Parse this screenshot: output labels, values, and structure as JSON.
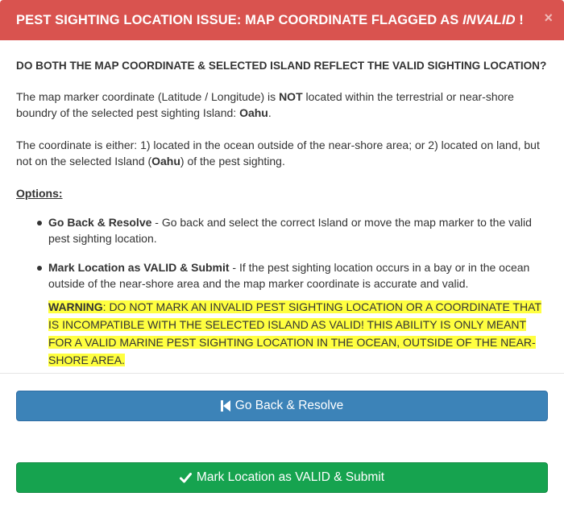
{
  "header": {
    "title_prefix": "PEST SIGHTING LOCATION ISSUE: MAP COORDINATE FLAGGED AS ",
    "title_emph": "INVALID",
    "title_suffix": " !",
    "close_label": "×"
  },
  "question": "DO BOTH THE MAP COORDINATE & SELECTED ISLAND REFLECT THE VALID SIGHTING LOCATION?",
  "para1": {
    "part1": "The map marker coordinate (Latitude / Longitude) is ",
    "not": "NOT",
    "part2": " located within the terrestrial or near-shore boundry of the selected pest sighting Island:  ",
    "island": "Oahu",
    "part3": "."
  },
  "para2": {
    "part1": "The coordinate is either:  1) located in the ocean outside of the near-shore area; or 2) located on land, but not on the selected Island (",
    "island": "Oahu",
    "part2": ") of the pest sighting."
  },
  "options_heading": "Options:",
  "options": [
    {
      "title": "Go Back & Resolve",
      "text": " - Go back and select the correct Island or move the map marker to the valid pest sighting location."
    },
    {
      "title": "Mark Location as VALID & Submit",
      "text": " - If the pest sighting location occurs in a bay or in the ocean outside of the near-shore area and the map marker coordinate is accurate and valid."
    }
  ],
  "warning": {
    "label": "WARNING",
    "text": ": DO NOT MARK AN INVALID PEST SIGHTING LOCATION OR A COORDINATE THAT IS INCOMPATIBLE WITH THE SELECTED ISLAND AS VALID! THIS ABILITY IS ONLY MEANT FOR A VALID MARINE PEST SIGHTING LOCATION IN THE OCEAN, OUTSIDE OF THE NEAR-SHORE AREA."
  },
  "buttons": {
    "back_label": "Go Back & Resolve",
    "back_icon": "step-backward-icon",
    "submit_label": "Mark Location as VALID & Submit",
    "submit_icon": "checkmark-icon"
  },
  "colors": {
    "header_bg": "#d9534f",
    "back_button": "#3c83b8",
    "submit_button": "#16a34f",
    "warning_highlight": "#ffff40"
  }
}
